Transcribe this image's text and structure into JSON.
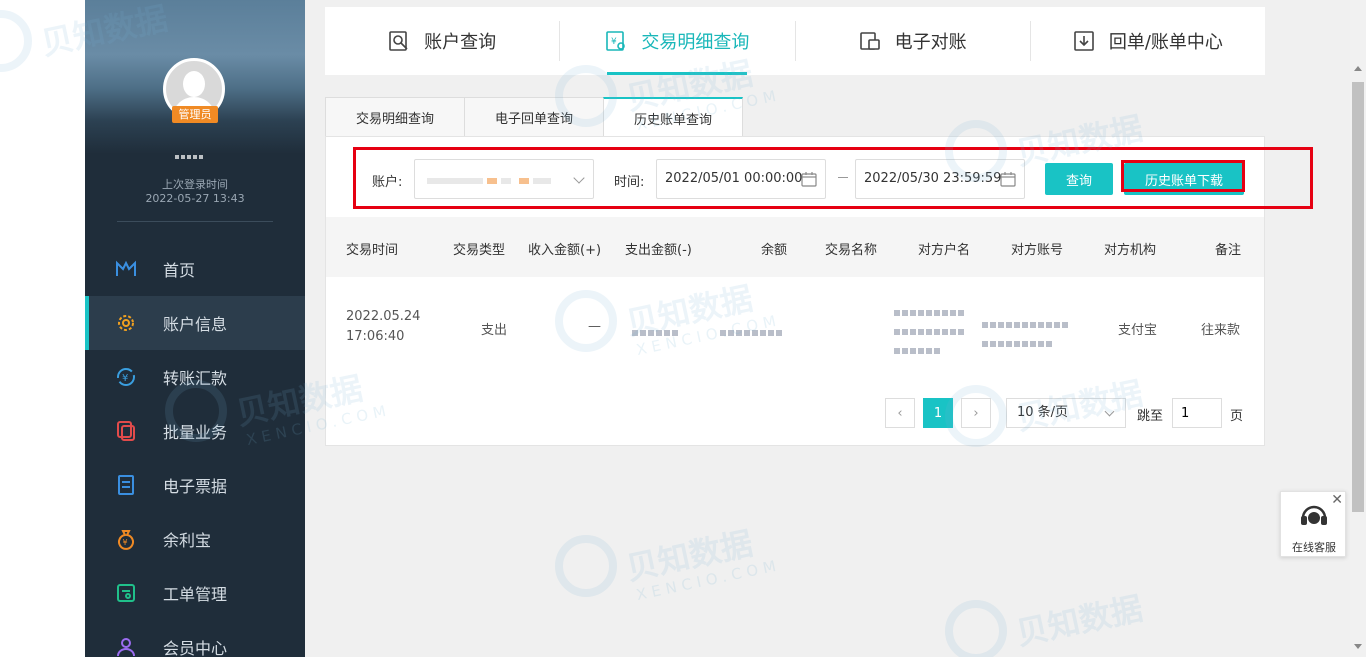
{
  "sidebar": {
    "role_badge": "管理员",
    "last_login_label": "上次登录时间",
    "last_login_time": "2022-05-27 13:43",
    "items": [
      {
        "label": "首页"
      },
      {
        "label": "账户信息"
      },
      {
        "label": "转账汇款"
      },
      {
        "label": "批量业务"
      },
      {
        "label": "电子票据"
      },
      {
        "label": "余利宝"
      },
      {
        "label": "工单管理"
      },
      {
        "label": "会员中心"
      }
    ]
  },
  "topnav": {
    "items": [
      {
        "label": "账户查询",
        "icon": "account-search-icon"
      },
      {
        "label": "交易明细查询",
        "icon": "transaction-detail-icon"
      },
      {
        "label": "电子对账",
        "icon": "reconciliation-icon"
      },
      {
        "label": "回单/账单中心",
        "icon": "receipt-download-icon"
      }
    ],
    "active_index": 1
  },
  "subtabs": [
    "交易明细查询",
    "电子回单查询",
    "历史账单查询"
  ],
  "filter": {
    "account_label": "账户:",
    "time_label": "时间:",
    "start_time": "2022/05/01 00:00:00",
    "end_time": "2022/05/30 23:59:59",
    "query_button": "查询",
    "download_button": "历史账单下载"
  },
  "table": {
    "headers": [
      "交易时间",
      "交易类型",
      "收入金额(+)",
      "支出金额(-)",
      "余额",
      "交易名称",
      "对方户名",
      "对方账号",
      "对方机构",
      "备注"
    ],
    "rows": [
      {
        "time_date": "2022.05.24",
        "time_clock": "17:06:40",
        "type": "支出",
        "income": "—",
        "org": "支付宝",
        "note": "往来款"
      }
    ]
  },
  "pagination": {
    "current_page": "1",
    "page_size": "10 条/页",
    "jump_label": "跳至",
    "jump_value": "1",
    "page_suffix": "页"
  },
  "chat": {
    "label": "在线客服"
  },
  "watermark": {
    "brand": "贝知数据",
    "sub": "XENCIO.COM"
  },
  "colors": {
    "accent": "#19c3c5",
    "highlight": "#e60012",
    "sidebar": "#1f2d3a",
    "badge": "#f08a24"
  }
}
